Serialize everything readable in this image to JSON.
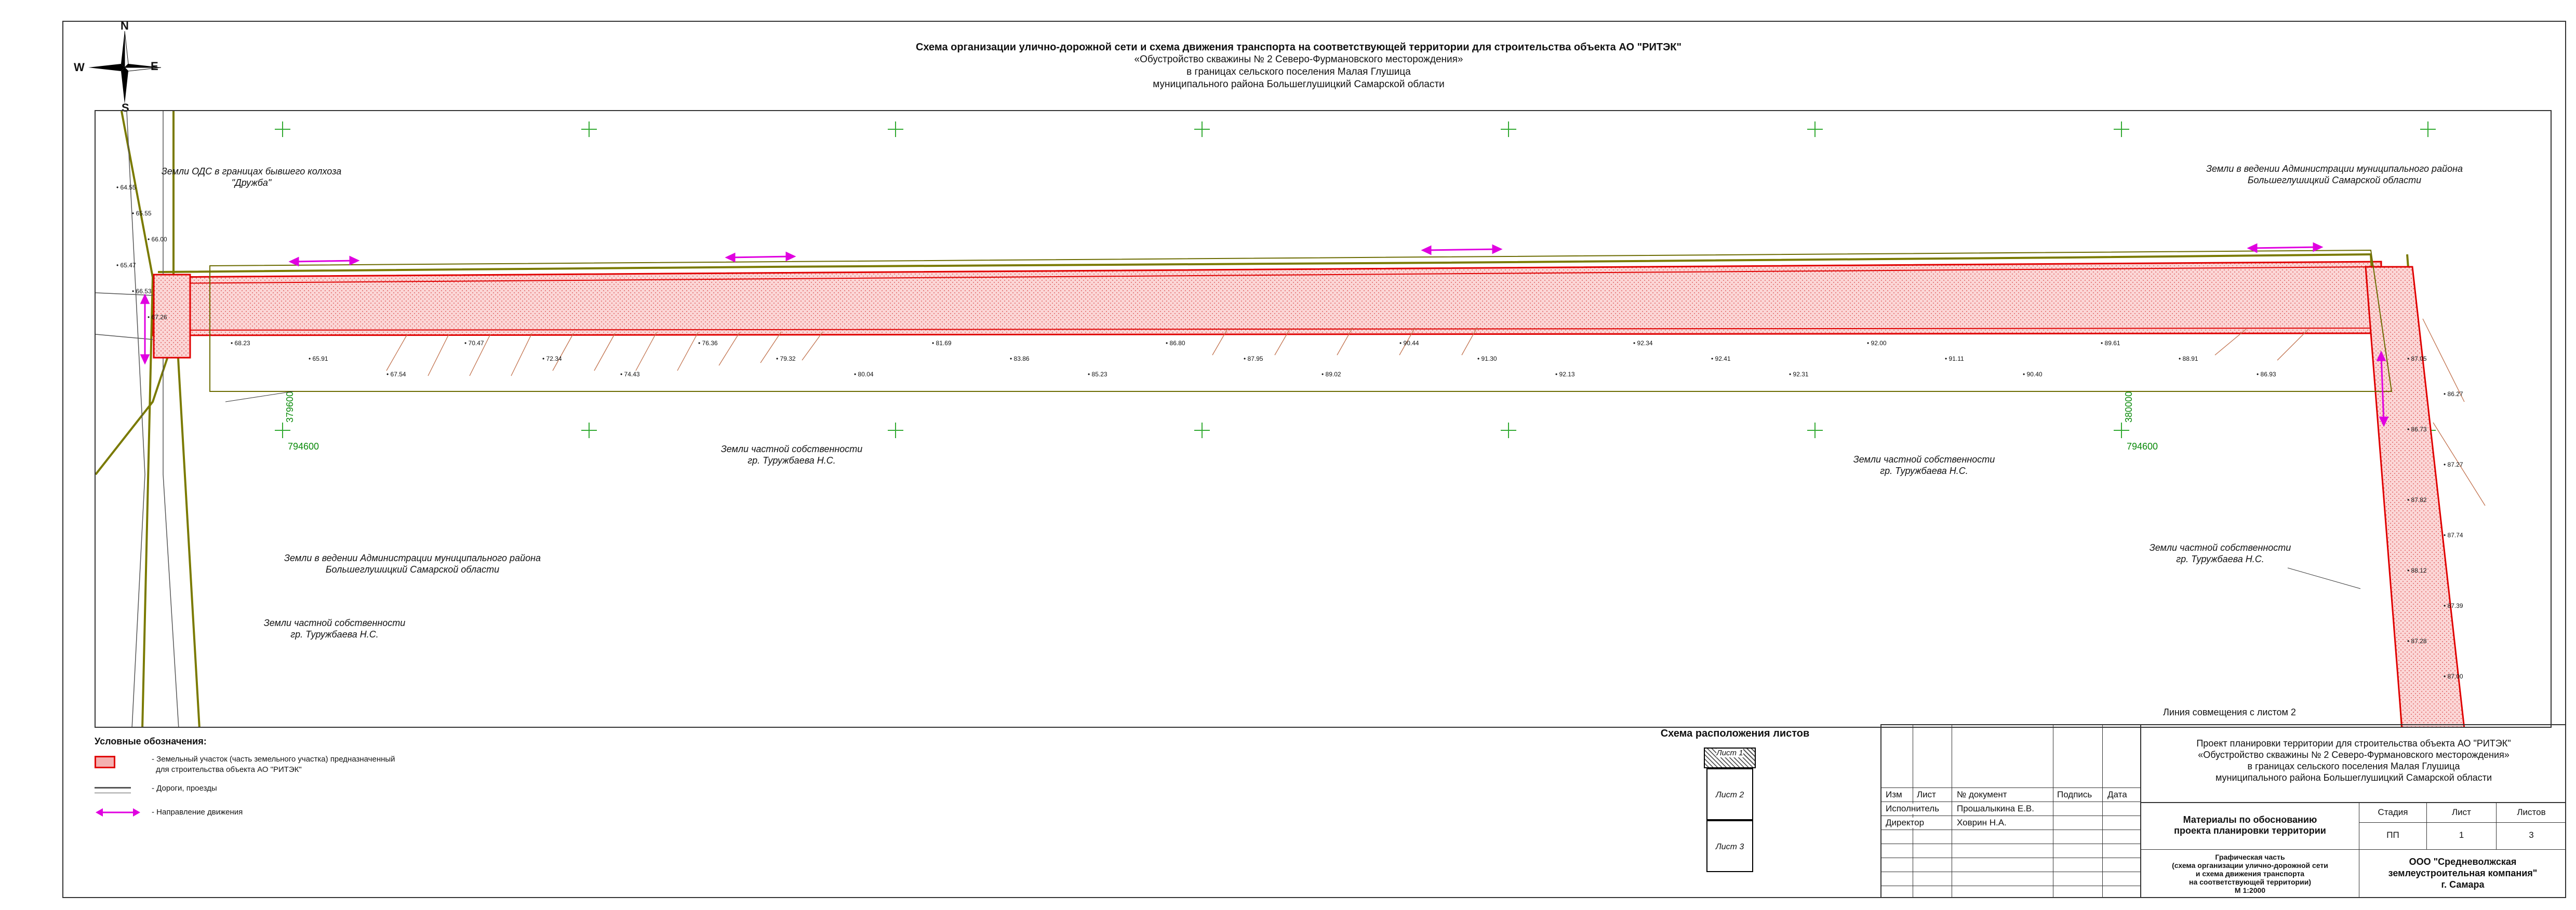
{
  "compass": {
    "n": "N",
    "s": "S",
    "e": "E",
    "w": "W"
  },
  "title": {
    "line1": "Схема организации улично-дорожной сети и схема движения транспорта на соответствующей территории для строительства объекта АО \"РИТЭК\"",
    "line2": "«Обустройство скважины № 2 Северо-Фурмановского месторождения»",
    "line3": "в границах сельского поселения Малая Глушица",
    "line4": "муниципального района Большеглушицкий Самарской области"
  },
  "map_labels": {
    "ods": "Земли ОДС в границах бывшего колхоза \"Дружба\"",
    "admin_right": "Земли в ведении Администрации муниципального района\nБольшеглушицкий Самарской области",
    "private_center": "Земли частной собственности\nгр. Туружбаева Н.С.",
    "private_right": "Земли частной собственности\nгр. Туружбаева Н.С.",
    "admin_left": "Земли в ведении Администрации муниципального района\nБольшеглушицкий Самарской области",
    "private_left": "Земли частной собственности\nгр. Туружбаева Н.С.",
    "private_far_right": "Земли частной собственности\nгр. Туружбаева Н.С.",
    "joint_line": "Линия совмещения с листом 2",
    "coord_x1": "379600",
    "coord_y1": "794600",
    "coord_x2": "380000",
    "coord_y2": "794600"
  },
  "elevations": [
    "64.55",
    "65.55",
    "66.00",
    "65.47",
    "66.53",
    "67.26",
    "68.23",
    "65.91",
    "67.54",
    "70.47",
    "72.34",
    "74.43",
    "76.36",
    "79.32",
    "80.04",
    "81.69",
    "83.86",
    "85.23",
    "86.80",
    "87.95",
    "89.02",
    "90.44",
    "91.30",
    "92.13",
    "92.34",
    "92.41",
    "92.31",
    "92.00",
    "91.11",
    "90.40",
    "89.61",
    "88.91",
    "86.93",
    "87.05",
    "86.27",
    "86.73",
    "87.27",
    "87.82",
    "87.74",
    "88.12",
    "87.39",
    "87.28",
    "87.00"
  ],
  "legend": {
    "title": "Условные обозначения:",
    "item1": "- Земельный участок (часть земельного участка) предназначенный",
    "item1b": "для строительства объекта АО \"РИТЭК\"",
    "item2": "- Дороги, проезды",
    "item3": "- Направление движения"
  },
  "sheets_scheme": {
    "title": "Схема расположения листов",
    "s1": "Лист 1",
    "s2": "Лист 2",
    "s3": "Лист 3"
  },
  "stamp": {
    "project1": "Проект планировки территории для строительства объекта АО \"РИТЭК\"",
    "project2": "«Обустройство скважины № 2 Северо-Фурмановского месторождения»",
    "project3": "в границах сельского поселения Малая Глушица",
    "project4": "муниципального района Большеглушицкий Самарской области",
    "h_izm": "Изм",
    "h_list": "Лист",
    "h_doc": "№ документ",
    "h_sign": "Подпись",
    "h_date": "Дата",
    "role1": "Исполнитель",
    "name1": "Прошалыкина Е.В.",
    "role2": "Директор",
    "name2": "Ховрин Н.А.",
    "materials": "Материалы по обоснованию\nпроекта планировки территории",
    "stage_h": "Стадия",
    "sheet_h": "Лист",
    "sheets_h": "Листов",
    "stage": "ПП",
    "sheet": "1",
    "sheets": "3",
    "graphic": "Графическая часть\n(схема организации улично-дорожной сети\nи схема движения транспорта\nна соответствующей территории)\nМ 1:2000",
    "org": "ООО \"Средневолжская\nземлеустроительная компания\"\nг. Самара"
  },
  "colors": {
    "road": "#7a7a00",
    "parcel": "#e00000",
    "arrow": "#e000e0",
    "cross": "#00aa00",
    "hatch": "#f4b0b0"
  }
}
